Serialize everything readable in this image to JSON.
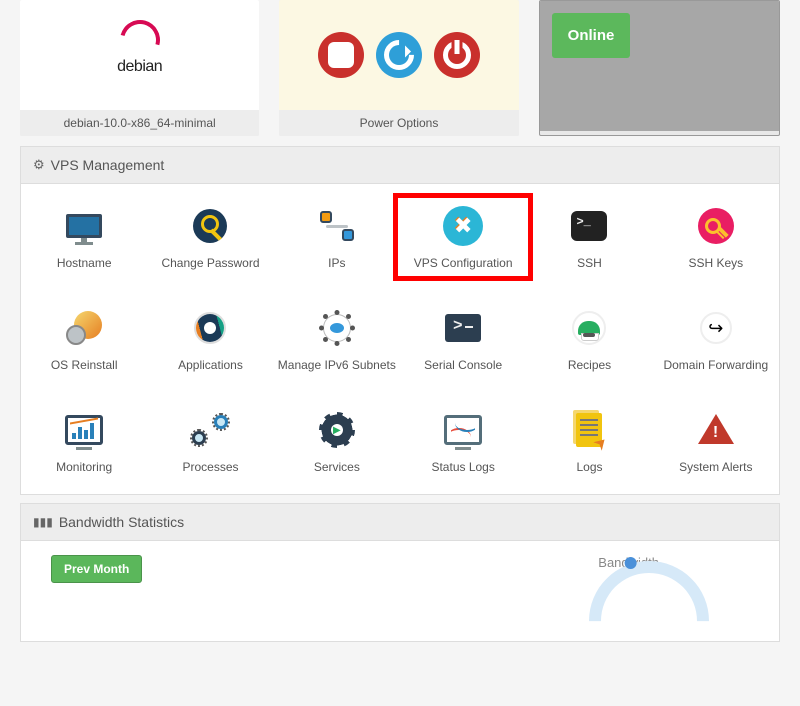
{
  "top": {
    "os_label": "debian-10.0-x86_64-minimal",
    "os_name": "debian",
    "power_label": "Power Options",
    "status": "Online"
  },
  "management": {
    "title": "VPS Management",
    "items": [
      {
        "label": "Hostname"
      },
      {
        "label": "Change Password"
      },
      {
        "label": "IPs"
      },
      {
        "label": "VPS Configuration"
      },
      {
        "label": "SSH"
      },
      {
        "label": "SSH Keys"
      },
      {
        "label": "OS Reinstall"
      },
      {
        "label": "Applications"
      },
      {
        "label": "Manage IPv6 Subnets"
      },
      {
        "label": "Serial Console"
      },
      {
        "label": "Recipes"
      },
      {
        "label": "Domain Forwarding"
      },
      {
        "label": "Monitoring"
      },
      {
        "label": "Processes"
      },
      {
        "label": "Services"
      },
      {
        "label": "Status Logs"
      },
      {
        "label": "Logs"
      },
      {
        "label": "System Alerts"
      }
    ]
  },
  "bandwidth": {
    "title": "Bandwidth Statistics",
    "prev_btn": "Prev Month",
    "chart_label": "Bandwidth"
  }
}
